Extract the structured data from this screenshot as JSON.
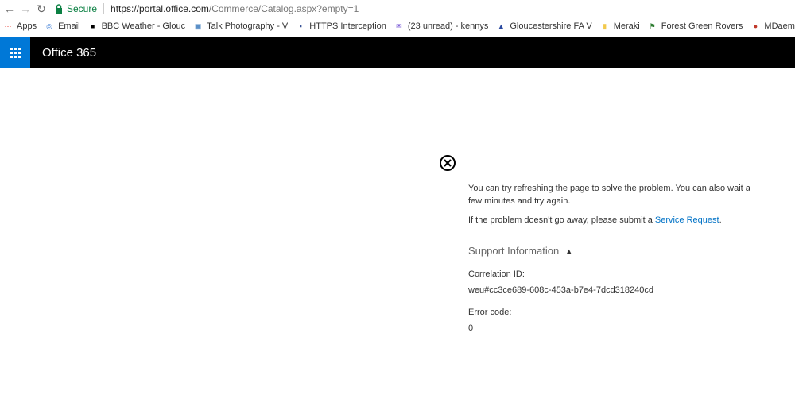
{
  "address_bar": {
    "secure_label": "Secure",
    "url_host": "https://portal.office.com",
    "url_path": "/Commerce/Catalog.aspx?empty=1"
  },
  "bookmarks": [
    {
      "label": "Apps",
      "icon": "apps-grid-icon",
      "color": "#e8453c"
    },
    {
      "label": "Email",
      "icon": "globe-icon",
      "color": "#3a7bd5"
    },
    {
      "label": "BBC Weather - Glouc",
      "icon": "bbc-icon",
      "color": "#000000"
    },
    {
      "label": "Talk Photography - V",
      "icon": "camera-icon",
      "color": "#5b8fc7"
    },
    {
      "label": "HTTPS Interception",
      "icon": "bookmark-site-icon",
      "color": "#1f3c88"
    },
    {
      "label": "(23 unread) - kennys",
      "icon": "mail-icon",
      "color": "#7b5bd6"
    },
    {
      "label": "Gloucestershire FA V",
      "icon": "crest-icon",
      "color": "#2b4aa0"
    },
    {
      "label": "Meraki",
      "icon": "folder-icon",
      "color": "#f2c94c"
    },
    {
      "label": "Forest Green Rovers",
      "icon": "flag-icon",
      "color": "#2e7d32"
    },
    {
      "label": "MDaemon Administ",
      "icon": "mdaemon-icon",
      "color": "#c0392b"
    }
  ],
  "suite_bar": {
    "title": "Office 365",
    "waffle_color": "#0078d7"
  },
  "error": {
    "message_1": "You can try refreshing the page to solve the problem. You can also wait a few minutes and try again.",
    "message_2_prefix": "If the problem doesn't go away, please submit a ",
    "message_2_link": "Service Request",
    "message_2_suffix": ".",
    "support_heading": "Support Information",
    "correlation_label": "Correlation ID:",
    "correlation_value": "weu#cc3ce689-608c-453a-b7e4-7dcd318240cd",
    "error_code_label": "Error code:",
    "error_code_value": "0"
  }
}
